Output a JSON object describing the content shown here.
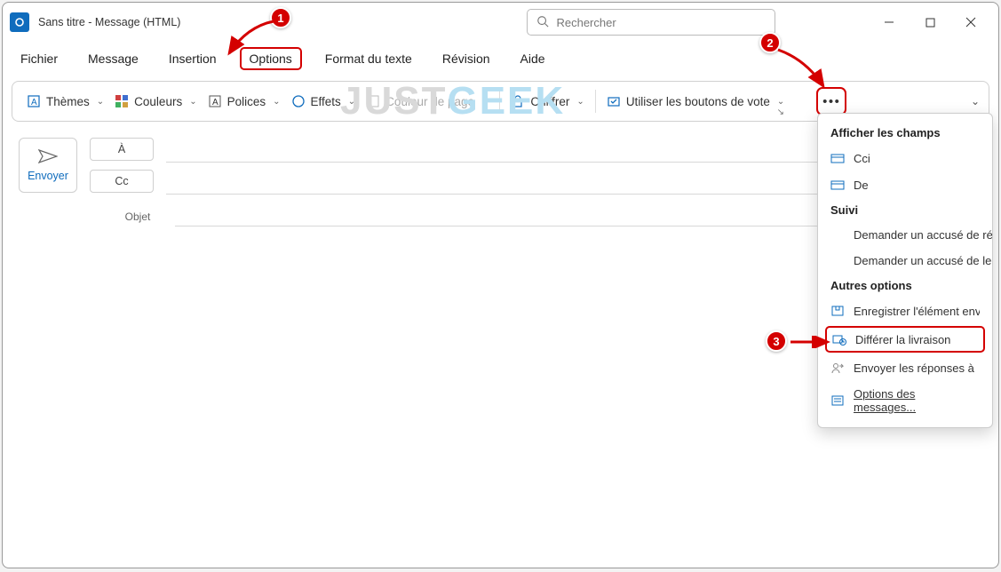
{
  "title": "Sans titre  -  Message (HTML)",
  "search": {
    "placeholder": "Rechercher"
  },
  "tabs": {
    "fichier": "Fichier",
    "message": "Message",
    "insertion": "Insertion",
    "options": "Options",
    "format": "Format du texte",
    "revision": "Révision",
    "aide": "Aide"
  },
  "ribbon": {
    "themes": "Thèmes",
    "couleurs": "Couleurs",
    "polices": "Polices",
    "effets": "Effets",
    "couleur_page": "Couleur de page",
    "chiffrer": "Chiffrer",
    "vote": "Utiliser les boutons de vote"
  },
  "compose": {
    "send": "Envoyer",
    "to": "À",
    "cc": "Cc",
    "subject": "Objet"
  },
  "dropdown": {
    "h1": "Afficher les champs",
    "cci": "Cci",
    "de": "De",
    "h2": "Suivi",
    "accuse_recep": "Demander un accusé de réception",
    "accuse_lect": "Demander un accusé de lecture",
    "h3": "Autres options",
    "enreg": "Enregistrer l'élément envoyé dans",
    "differer": "Différer la livraison",
    "reponses": "Envoyer les réponses à",
    "options_msg": "Options des messages..."
  },
  "badges": {
    "b1": "1",
    "b2": "2",
    "b3": "3"
  },
  "watermark": {
    "part1": "JUST",
    "part2": "GEEK"
  }
}
